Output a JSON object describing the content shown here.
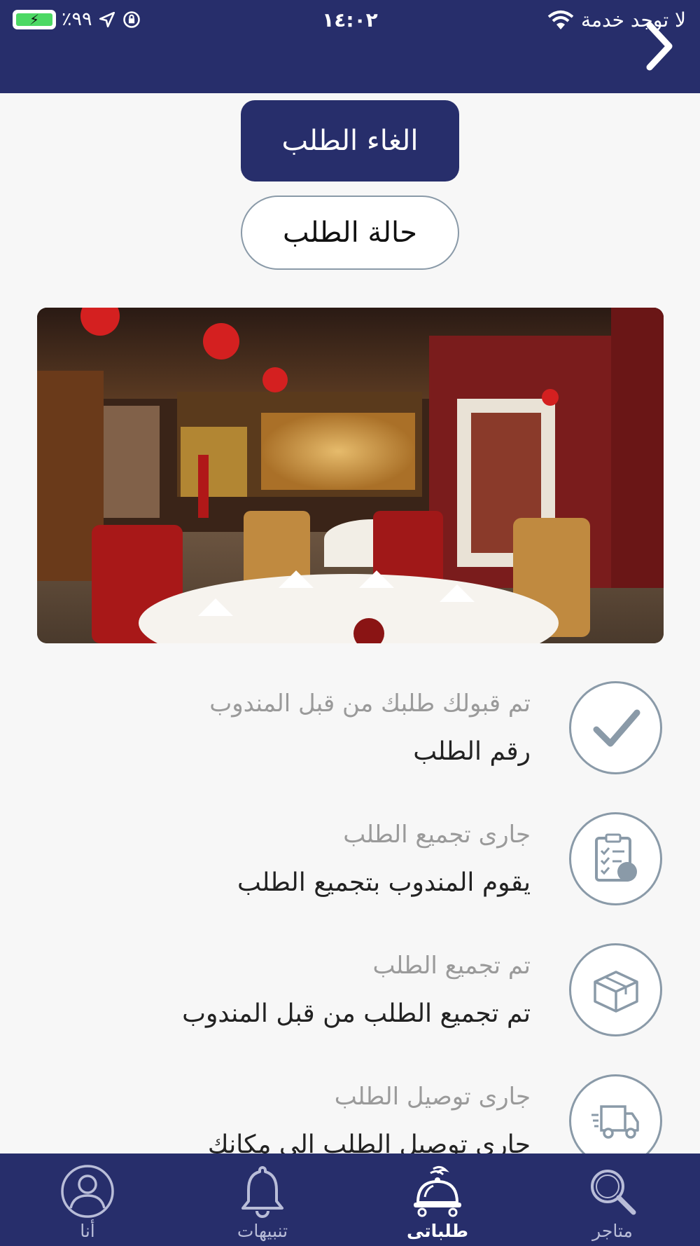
{
  "status_bar": {
    "carrier": "لا توجد خدمة",
    "time": "١٤:٠٢",
    "battery": "٪٩٩"
  },
  "actions": {
    "cancel_label": "الغاء الطلب",
    "status_label": "حالة الطلب"
  },
  "steps": [
    {
      "title": "تم قبولك طلبك من قبل المندوب",
      "desc": "رقم الطلب",
      "icon": "check-icon"
    },
    {
      "title": "جارى تجميع الطلب",
      "desc": "يقوم المندوب بتجميع الطلب",
      "icon": "checklist-icon"
    },
    {
      "title": "تم تجميع الطلب",
      "desc": "تم تجميع الطلب من قبل المندوب",
      "icon": "box-icon"
    },
    {
      "title": "جارى توصيل الطلب",
      "desc": "جارى توصيل الطلب الى مكانك",
      "icon": "truck-icon"
    }
  ],
  "tabs": [
    {
      "label": "متاجر",
      "icon": "search-icon",
      "active": false
    },
    {
      "label": "طلباتى",
      "icon": "food-cloche-icon",
      "active": true
    },
    {
      "label": "تنبيهات",
      "icon": "bell-icon",
      "active": false
    },
    {
      "label": "أنا",
      "icon": "profile-icon",
      "active": false
    }
  ],
  "colors": {
    "primary": "#272e6b",
    "background": "#f7f7f7",
    "icon_stroke": "#8a9aa8"
  }
}
